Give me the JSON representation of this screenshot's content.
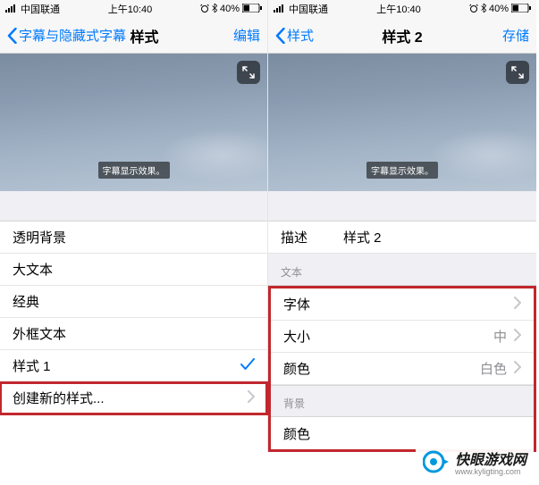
{
  "status": {
    "carrier": "中国联通",
    "time": "上午10:40",
    "battery": "40%"
  },
  "left": {
    "back_label": "字幕与隐藏式字幕",
    "title": "样式",
    "action": "编辑",
    "subtitle_sample": "字幕显示效果。",
    "rows": {
      "transparent": "透明背景",
      "large": "大文本",
      "classic": "经典",
      "outline": "外框文本",
      "style1": "样式 1",
      "create": "创建新的样式..."
    }
  },
  "right": {
    "back_label": "样式",
    "title": "样式 2",
    "action": "存储",
    "subtitle_sample": "字幕显示效果。",
    "desc_label": "描述",
    "desc_value": "样式 2",
    "section_text": "文本",
    "section_bg": "背景",
    "text_rows": {
      "font": "字体",
      "size": "大小",
      "size_value": "中",
      "color": "颜色",
      "color_value": "白色"
    },
    "bg_rows": {
      "color": "颜色"
    }
  },
  "watermark": {
    "name": "快眼游戏网",
    "url": "www.kyligting.com"
  }
}
